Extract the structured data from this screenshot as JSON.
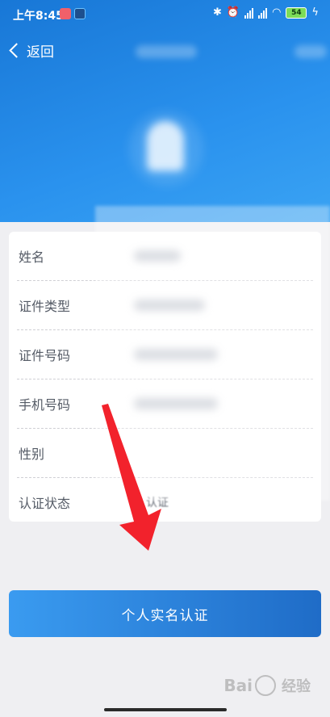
{
  "status_bar": {
    "time": "上午8:45",
    "battery": "54"
  },
  "nav": {
    "back_label": "返回"
  },
  "info": {
    "rows": [
      {
        "label": "姓名"
      },
      {
        "label": "证件类型"
      },
      {
        "label": "证件号码"
      },
      {
        "label": "手机号码"
      },
      {
        "label": "性别"
      },
      {
        "label": "认证状态",
        "value": "认证"
      }
    ]
  },
  "action": {
    "button_label": "个人实名认证"
  },
  "watermark": {
    "brand_a": "Bai",
    "brand_b": "经验"
  },
  "colors": {
    "header_blue": "#1f80dd",
    "button_blue": "#2a7fd8",
    "arrow_red": "#f2222c"
  }
}
